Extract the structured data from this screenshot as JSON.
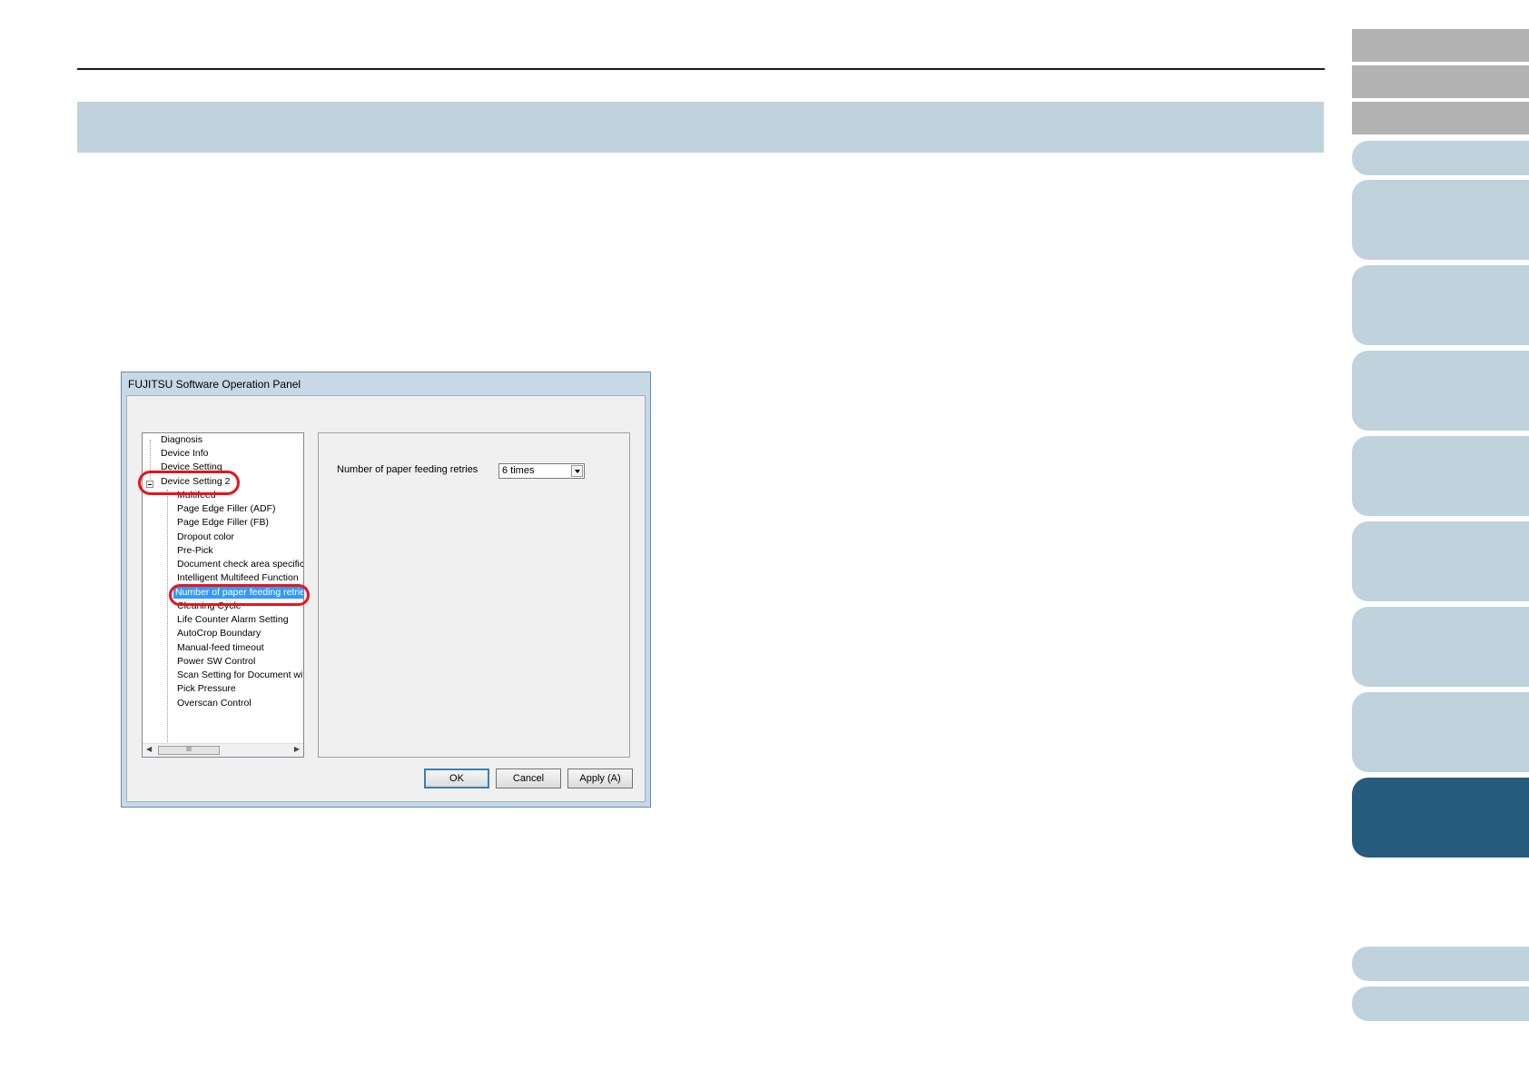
{
  "dialog": {
    "title": "FUJITSU Software Operation Panel",
    "tree": {
      "items": [
        {
          "label": "Diagnosis"
        },
        {
          "label": "Device Info"
        },
        {
          "label": "Device Setting"
        },
        {
          "label": "Device Setting 2"
        },
        {
          "label": "Multifeed"
        },
        {
          "label": "Page Edge Filler (ADF)"
        },
        {
          "label": "Page Edge Filler (FB)"
        },
        {
          "label": "Dropout color"
        },
        {
          "label": "Pre-Pick"
        },
        {
          "label": "Document check area specific"
        },
        {
          "label": "Intelligent Multifeed Function"
        },
        {
          "label": "Number of paper feeding retries"
        },
        {
          "label": "Cleaning Cycle"
        },
        {
          "label": "Life Counter Alarm Setting"
        },
        {
          "label": "AutoCrop Boundary"
        },
        {
          "label": "Manual-feed timeout"
        },
        {
          "label": "Power SW Control"
        },
        {
          "label": "Scan Setting for Document wit"
        },
        {
          "label": "Pick Pressure"
        },
        {
          "label": "Overscan Control"
        }
      ],
      "selected": "Number of paper feeding retries",
      "scroll_thumb": "III"
    },
    "setting": {
      "label": "Number of paper feeding retries",
      "value": "6 times"
    },
    "buttons": {
      "ok": "OK",
      "cancel": "Cancel",
      "apply": "Apply (A)"
    }
  },
  "colors": {
    "title_band": "#c0d2dc",
    "nav_tab": "#c0d2dc",
    "nav_tab_active": "#285c7e",
    "nav_tab_gray": "#b3b3b3",
    "highlight_ring": "#e8141b",
    "selection": "#3399ff"
  }
}
